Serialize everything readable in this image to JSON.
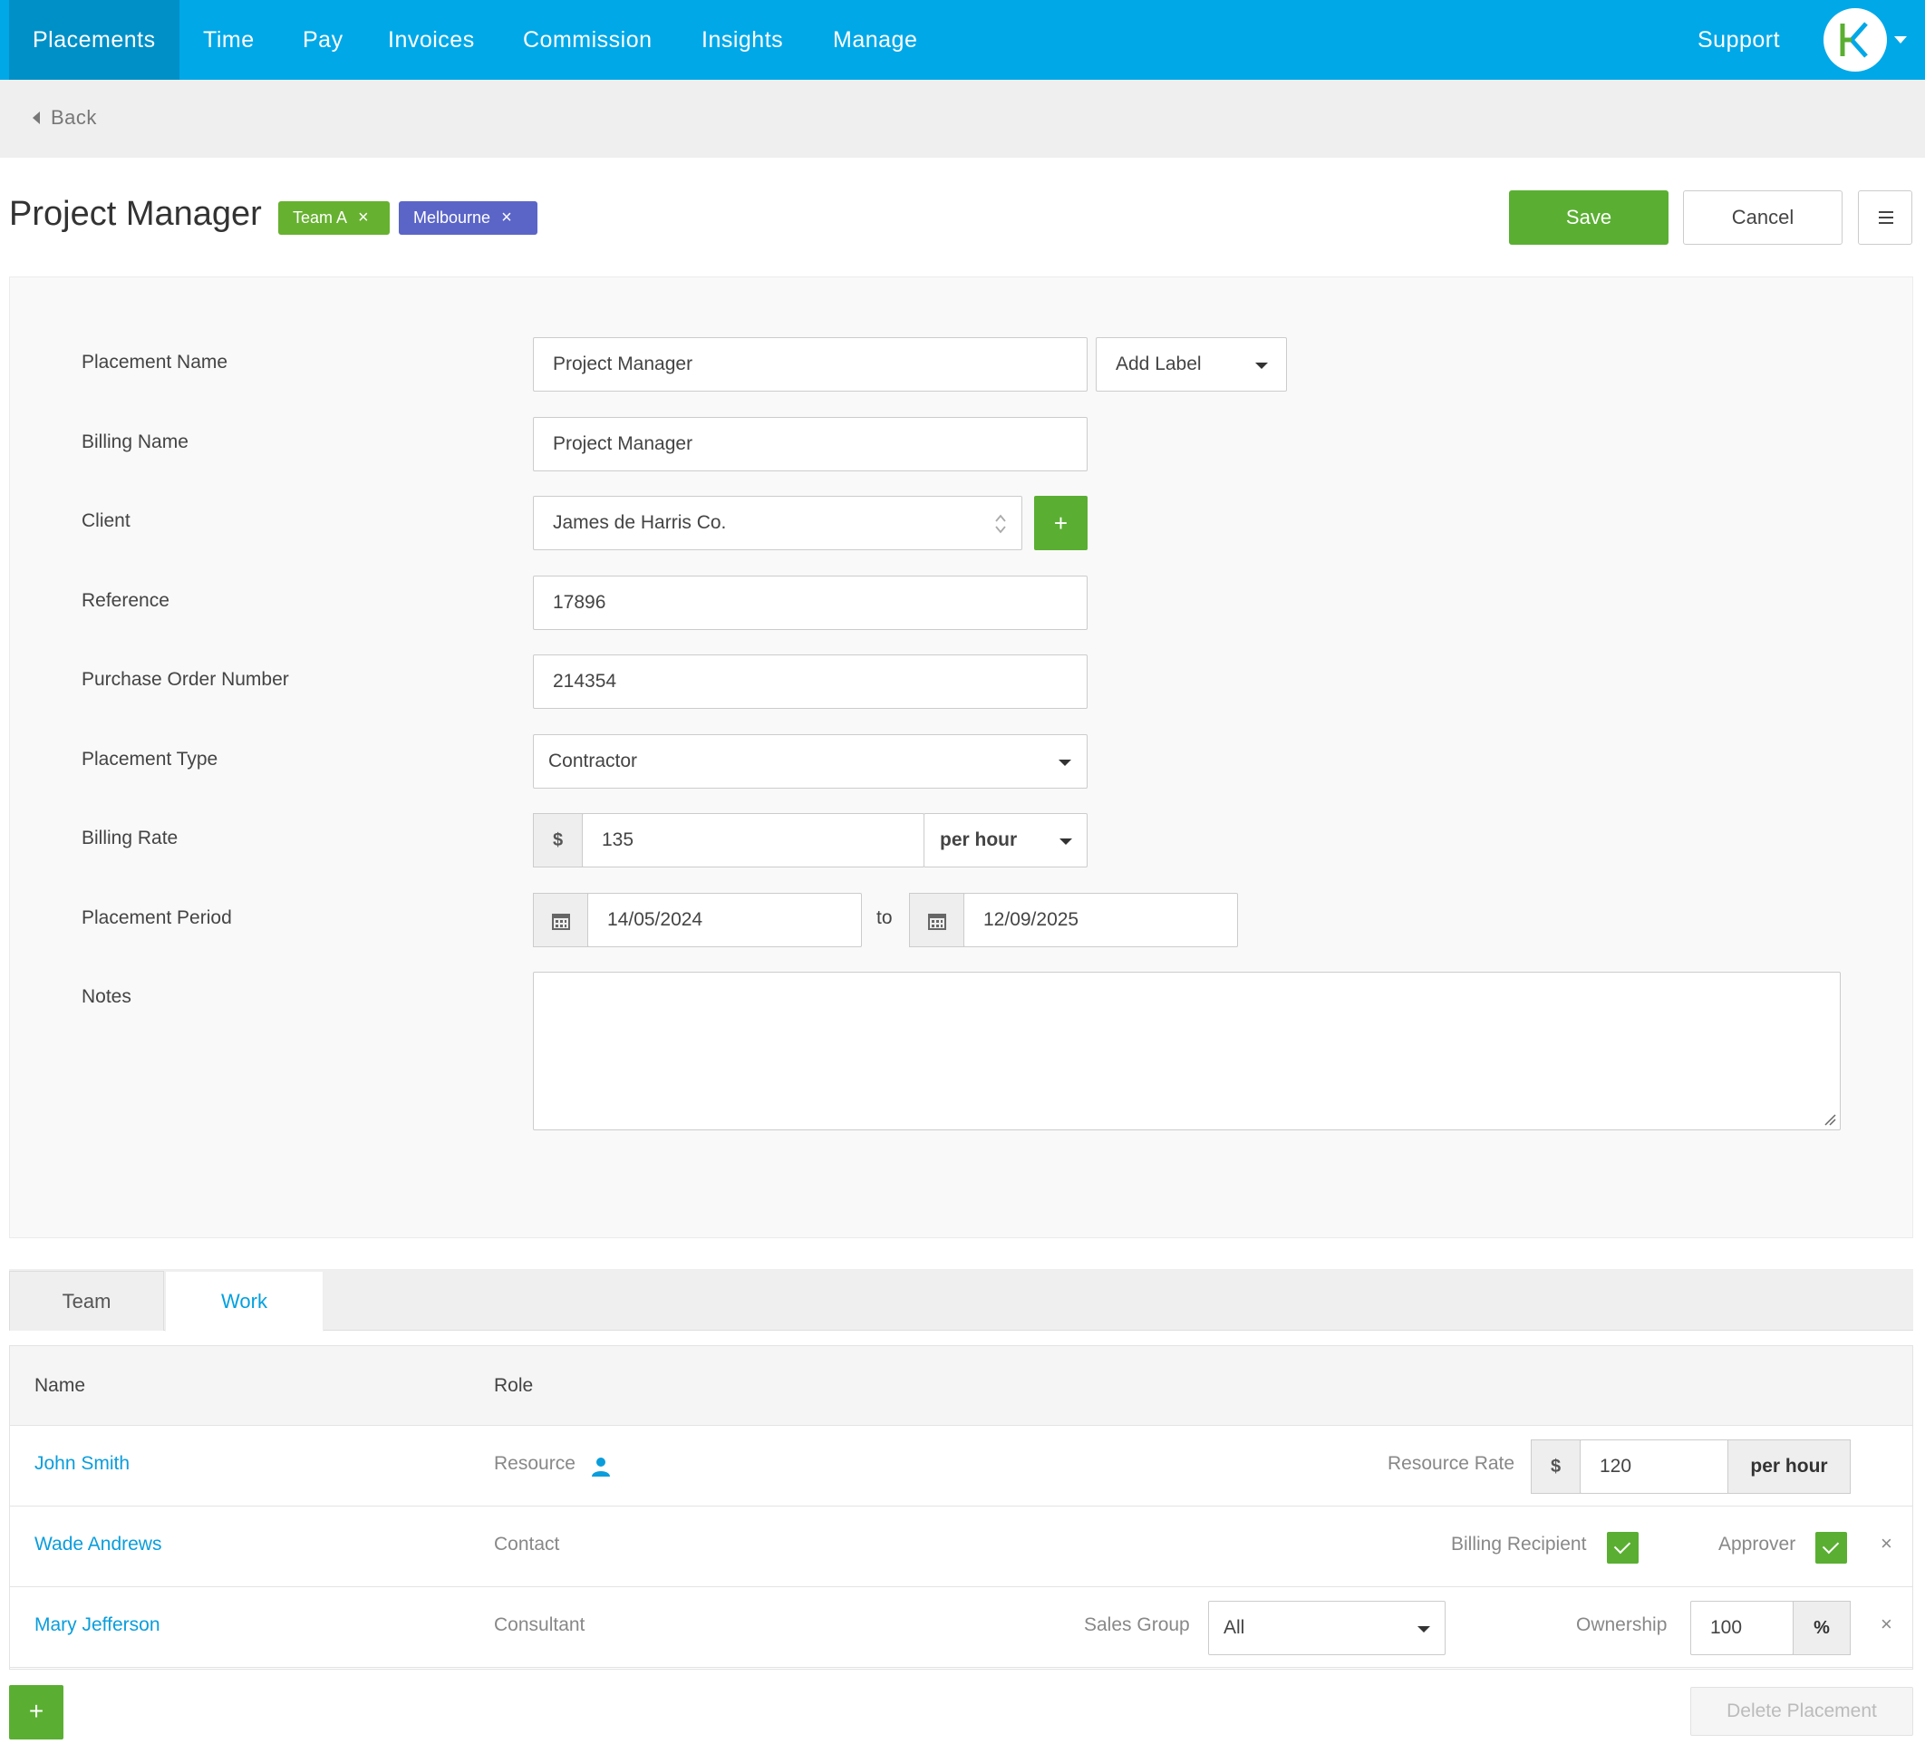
{
  "nav": {
    "items": [
      "Placements",
      "Time",
      "Pay",
      "Invoices",
      "Commission",
      "Insights",
      "Manage"
    ],
    "support": "Support",
    "brand_color": "#00a8e8"
  },
  "back_label": "Back",
  "header": {
    "title": "Project Manager",
    "tags": [
      {
        "label": "Team A",
        "color": "#67b130"
      },
      {
        "label": "Melbourne",
        "color": "#5b65c7"
      }
    ],
    "save_label": "Save",
    "cancel_label": "Cancel"
  },
  "form": {
    "placement_name": {
      "label": "Placement Name",
      "value": "Project Manager",
      "add_label": "Add Label"
    },
    "billing_name": {
      "label": "Billing Name",
      "value": "Project Manager"
    },
    "client": {
      "label": "Client",
      "value": "James de Harris Co.",
      "add_symbol": "+"
    },
    "reference": {
      "label": "Reference",
      "value": "17896"
    },
    "po_number": {
      "label": "Purchase Order Number",
      "value": "214354"
    },
    "placement_type": {
      "label": "Placement Type",
      "value": "Contractor"
    },
    "billing_rate": {
      "label": "Billing Rate",
      "currency": "$",
      "value": "135",
      "unit": "per hour"
    },
    "period": {
      "label": "Placement Period",
      "start": "14/05/2024",
      "to": "to",
      "end": "12/09/2025"
    },
    "notes": {
      "label": "Notes",
      "value": ""
    }
  },
  "tabs": [
    "Team",
    "Work"
  ],
  "team_table": {
    "headers": [
      "Name",
      "Role"
    ],
    "rows": [
      {
        "name": "John Smith",
        "role": "Resource",
        "rate_label": "Resource Rate",
        "currency": "$",
        "rate": "120",
        "unit": "per hour"
      },
      {
        "name": "Wade Andrews",
        "role": "Contact",
        "billing_recipient_label": "Billing Recipient",
        "approver_label": "Approver",
        "billing_recipient": true,
        "approver": true
      },
      {
        "name": "Mary Jefferson",
        "role": "Consultant",
        "sales_group_label": "Sales Group",
        "sales_group": "All",
        "ownership_label": "Ownership",
        "ownership": "100",
        "percent": "%"
      }
    ]
  },
  "add_row_symbol": "+",
  "delete_label": "Delete Placement"
}
